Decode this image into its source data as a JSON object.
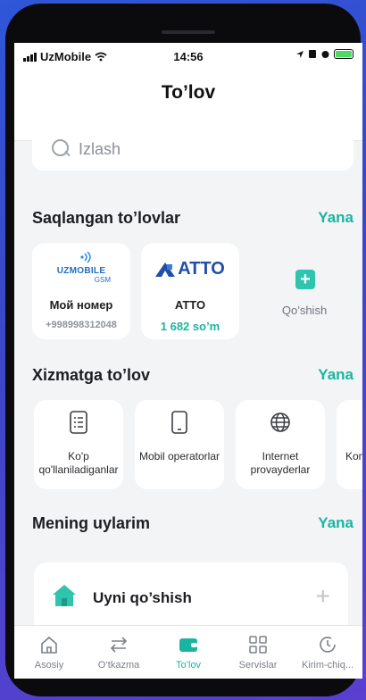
{
  "status_bar": {
    "carrier": "UzMobile",
    "time": "14:56"
  },
  "header": {
    "title": "To’lov"
  },
  "search": {
    "placeholder": "Izlash"
  },
  "saved": {
    "title": "Saqlangan to’lovlar",
    "more": "Yana",
    "items": [
      {
        "logo": "UZMOBILE GSM",
        "name": "Мой номер",
        "sub": "+998998312048"
      },
      {
        "logo": "ATTO",
        "name": "ATTO",
        "sub": "1 682 so’m"
      }
    ],
    "add_label": "Qo’shish"
  },
  "services": {
    "title": "Xizmatga to’lov",
    "more": "Yana",
    "items": [
      {
        "label": "Ko'p qo'llaniladiganlar",
        "icon": "list-icon"
      },
      {
        "label": "Mobil operatorlar",
        "icon": "phone-icon"
      },
      {
        "label": "Internet provayderlar",
        "icon": "globe-icon"
      },
      {
        "label": "Kom xiz",
        "icon": "utility-icon"
      }
    ]
  },
  "homes": {
    "title": "Mening uylarim",
    "more": "Yana",
    "add_label": "Uyni qo’shish"
  },
  "tabbar": {
    "items": [
      {
        "label": "Asosiy",
        "icon": "home-outline-icon"
      },
      {
        "label": "O‘tkazma",
        "icon": "transfer-icon"
      },
      {
        "label": "To’lov",
        "icon": "wallet-icon",
        "active": true
      },
      {
        "label": "Servislar",
        "icon": "grid-icon"
      },
      {
        "label": "Kirim-chiq...",
        "icon": "history-icon"
      }
    ]
  },
  "colors": {
    "accent": "#19b5a2",
    "background": "#f3f4f6"
  }
}
